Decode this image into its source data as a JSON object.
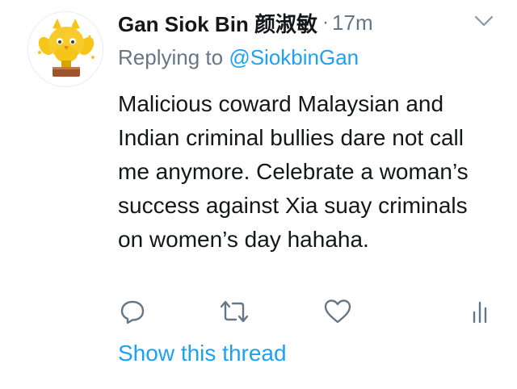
{
  "tweet": {
    "display_name": "Gan Siok Bin 颜淑敏",
    "separator": "·",
    "timestamp": "17m",
    "replying_prefix": "Replying to ",
    "replying_handle": "@SiokbinGan",
    "body": "Malicious coward Malaysian and Indian criminal bullies dare not call me anymore. Celebrate a woman’s success against Xia suay criminals on women’s day hahaha.",
    "show_thread": "Show this thread"
  },
  "icons": {
    "avatar": "yellow-owl-trophy-avatar",
    "menu": "chevron-down-icon",
    "reply": "speech-bubble-icon",
    "retweet": "retweet-arrows-icon",
    "like": "heart-icon",
    "analytics": "bar-chart-icon"
  },
  "colors": {
    "text": "#14171a",
    "secondary": "#657786",
    "link": "#1da1f2",
    "icon": "#657786",
    "avatar_yellow": "#f5c518"
  }
}
